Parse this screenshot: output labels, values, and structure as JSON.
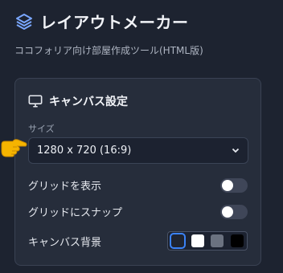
{
  "app": {
    "title": "レイアウトメーカー",
    "subtitle": "ココフォリア向け部屋作成ツール(HTML版)"
  },
  "panel": {
    "title": "キャンバス設定",
    "size_label": "サイズ",
    "size_value": "1280 x 720 (16:9)",
    "show_grid_label": "グリッドを表示",
    "show_grid": false,
    "snap_grid_label": "グリッドにスナップ",
    "snap_grid": false,
    "background_label": "キャンバス背景",
    "background_options": [
      "#1f2430",
      "#ffffff",
      "#6b7280",
      "#000000"
    ],
    "background_selected": 0
  },
  "colors": {
    "accent": "#3b82f6",
    "hand": "#f5b400"
  }
}
